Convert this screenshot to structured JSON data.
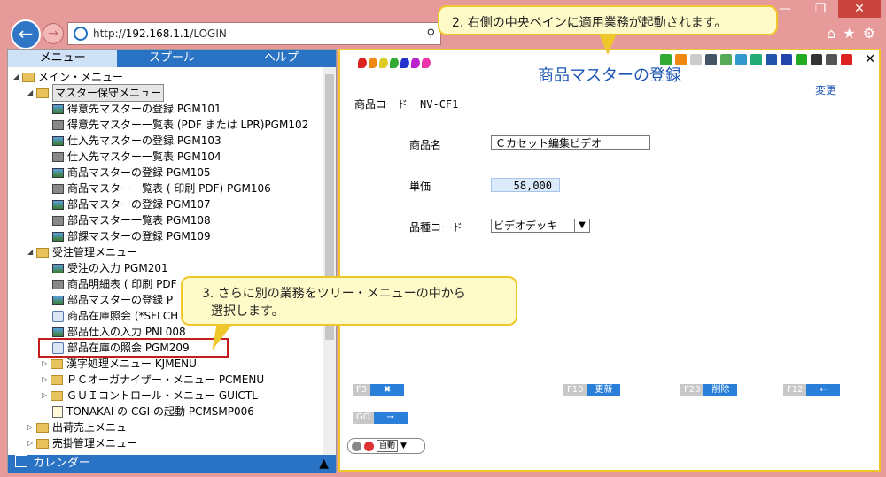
{
  "browser": {
    "address_prefix": "http://",
    "address_host": "192.168.1.1",
    "address_path": "/LOGIN"
  },
  "tabs": [
    "メニュー",
    "スプール",
    "ヘルプ"
  ],
  "tree": [
    {
      "label": "メイン・メニュー",
      "type": "folder"
    },
    {
      "label": "マスター保守メニュー",
      "type": "folder"
    },
    {
      "label": "得意先マスターの登録 PGM101",
      "type": "pgm"
    },
    {
      "label": "得意先マスター一覧表 (PDF または LPR)PGM102",
      "type": "print"
    },
    {
      "label": "仕入先マスターの登録 PGM103",
      "type": "pgm"
    },
    {
      "label": "仕入先マスター一覧表 PGM104",
      "type": "print"
    },
    {
      "label": "商品マスターの登録 PGM105",
      "type": "pgm"
    },
    {
      "label": "商品マスター一覧表 ( 印刷 PDF) PGM106",
      "type": "print"
    },
    {
      "label": "部品マスターの登録 PGM107",
      "type": "pgm"
    },
    {
      "label": "部品マスター一覧表 PGM108",
      "type": "print"
    },
    {
      "label": "部課マスターの登録 PGM109",
      "type": "pgm"
    },
    {
      "label": "受注管理メニュー",
      "type": "folder"
    },
    {
      "label": "受注の入力 PGM201",
      "type": "pgm"
    },
    {
      "label": "商品明細表 ( 印刷 PDF",
      "type": "print"
    },
    {
      "label": "部品マスターの登録 P",
      "type": "pgm"
    },
    {
      "label": "商品在庫照会 (*SFLCH",
      "type": "query"
    },
    {
      "label": "部品仕入の入力 PNL008",
      "type": "pgm"
    },
    {
      "label": "部品在庫の照会 PGM209",
      "type": "query"
    },
    {
      "label": "漢字処理メニュー KJMENU",
      "type": "folder"
    },
    {
      "label": "ＰＣオーガナイザー・メニュー PCMENU",
      "type": "folder"
    },
    {
      "label": "ＧＵＩコントロール・メニュー GUICTL",
      "type": "folder"
    },
    {
      "label": "TONAKAI の CGI の起動 PCMSMP006",
      "type": "cgi"
    },
    {
      "label": "出荷売上メニュー",
      "type": "folder"
    },
    {
      "label": "売掛管理メニュー",
      "type": "folder"
    }
  ],
  "calendar_label": "カレンダー",
  "app": {
    "title": "商品マスターの登録",
    "mode": "変更",
    "product_code_label": "商品コード",
    "product_code_value": "NV-CF1",
    "name_label": "商品名",
    "name_value": "Ｃカセット編集ビデオ",
    "price_label": "単価",
    "price_value": "58,000",
    "kind_label": "品種コード",
    "kind_value": "ビデオデッキ",
    "fkeys": {
      "f3": "F3",
      "f10": "F10",
      "f10_label": "更新",
      "f23": "F23",
      "f23_label": "削除",
      "f12": "F12",
      "go": "GO"
    },
    "auto_label": "自動"
  },
  "callouts": {
    "step2": "2. 右側の中央ペインに適用業務が起動されます。",
    "step3_line1": "3. さらに別の業務をツリー・メニューの中から",
    "step3_line2": "選択します。"
  },
  "colors": {
    "frame": "#e79a9a",
    "accent_blue": "#2a72c4",
    "callout_bg": "#fffbc8",
    "callout_border": "#f0c72b",
    "highlight_red": "#c41d1d"
  }
}
